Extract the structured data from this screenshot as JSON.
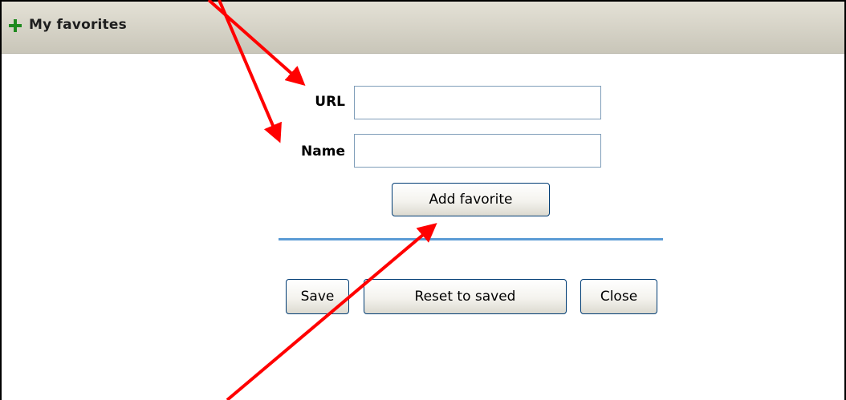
{
  "panel": {
    "title": "My favorites",
    "expand_icon": "plus-icon"
  },
  "form": {
    "url_label": "URL",
    "url_value": "",
    "name_label": "Name",
    "name_value": "",
    "add_label": "Add favorite"
  },
  "actions": {
    "save_label": "Save",
    "reset_label": "Reset to saved",
    "close_label": "Close"
  },
  "colors": {
    "header_bg": "#d6d3c7",
    "divider": "#5b9bd5",
    "annotation_arrow": "#ff0000",
    "plus_icon": "#1f8a1f"
  }
}
